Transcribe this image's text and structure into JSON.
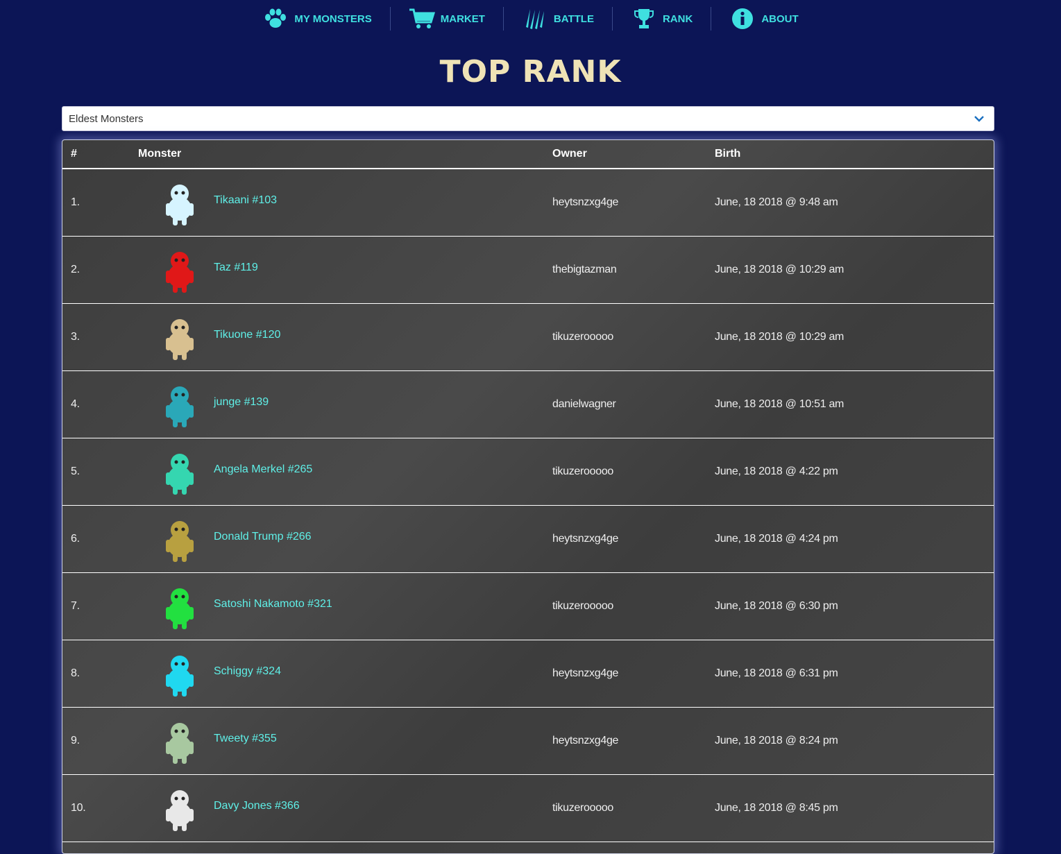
{
  "nav": {
    "items": [
      {
        "label": "MY MONSTERS",
        "icon": "paw-icon"
      },
      {
        "label": "MARKET",
        "icon": "cart-icon"
      },
      {
        "label": "BATTLE",
        "icon": "claw-icon"
      },
      {
        "label": "RANK",
        "icon": "trophy-icon"
      },
      {
        "label": "ABOUT",
        "icon": "info-icon"
      }
    ]
  },
  "page": {
    "title": "TOP RANK"
  },
  "filter": {
    "selected": "Eldest Monsters"
  },
  "table": {
    "headers": {
      "num": "#",
      "monster": "Monster",
      "owner": "Owner",
      "birth": "Birth"
    },
    "rows": [
      {
        "num": "1.",
        "monster": "Tikaani #103",
        "owner": "heytsnzxg4ge",
        "birth": "June, 18 2018 @ 9:48 am",
        "color": "#d6f4ff"
      },
      {
        "num": "2.",
        "monster": "Taz #119",
        "owner": "thebigtazman",
        "birth": "June, 18 2018 @ 10:29 am",
        "color": "#e01818"
      },
      {
        "num": "3.",
        "monster": "Tikuone #120",
        "owner": "tikuzerooooo",
        "birth": "June, 18 2018 @ 10:29 am",
        "color": "#d8c090"
      },
      {
        "num": "4.",
        "monster": "junge #139",
        "owner": "danielwagner",
        "birth": "June, 18 2018 @ 10:51 am",
        "color": "#2aa8b8"
      },
      {
        "num": "5.",
        "monster": "Angela Merkel #265",
        "owner": "tikuzerooooo",
        "birth": "June, 18 2018 @ 4:22 pm",
        "color": "#35d6b0"
      },
      {
        "num": "6.",
        "monster": "Donald Trump #266",
        "owner": "heytsnzxg4ge",
        "birth": "June, 18 2018 @ 4:24 pm",
        "color": "#b8a040"
      },
      {
        "num": "7.",
        "monster": "Satoshi Nakamoto #321",
        "owner": "tikuzerooooo",
        "birth": "June, 18 2018 @ 6:30 pm",
        "color": "#22e040"
      },
      {
        "num": "8.",
        "monster": "Schiggy #324",
        "owner": "heytsnzxg4ge",
        "birth": "June, 18 2018 @ 6:31 pm",
        "color": "#20d8f0"
      },
      {
        "num": "9.",
        "monster": "Tweety #355",
        "owner": "heytsnzxg4ge",
        "birth": "June, 18 2018 @ 8:24 pm",
        "color": "#a8c8a0"
      },
      {
        "num": "10.",
        "monster": "Davy Jones #366",
        "owner": "tikuzerooooo",
        "birth": "June, 18 2018 @ 8:45 pm",
        "color": "#e8e8e8"
      }
    ]
  },
  "colors": {
    "background": "#0c1556",
    "accent": "#3fe0e0",
    "title": "#efe3b6",
    "link": "#5ff0e8"
  }
}
